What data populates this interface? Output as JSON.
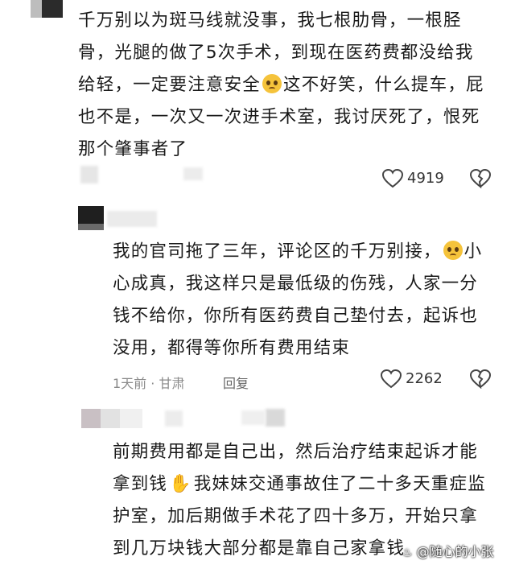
{
  "comment1": {
    "text": "千万别以为斑马线就没事，我七根肋骨，一根胫骨，光腿的做了5次手术，到现在医药费都没给我给轻，一定要注意安全🥺这不好笑，什么提车，屁也不是，一次又一次进手术室，我讨厌死了，恨死那个肇事者了",
    "likes": "4919"
  },
  "comment2": {
    "text": "我的官司拖了三年，评论区的千万别接，🥺小心成真，我这样只是最低级的伤残，人家一分钱不给你，你所有医药费自己垫付去，起诉也没用，都得等你所有费用结束",
    "time_location": "1天前 · 甘肃",
    "reply_label": "回复",
    "likes": "2262"
  },
  "comment3": {
    "text": "前期费用都是自己出，然后治疗结束起诉才能拿到钱🙏我妹妹交通事故住了二十多天重症监护室，加后期做手术花了四十多万，开始只拿到几万块钱大部分都是靠自己家拿钱"
  },
  "watermark": "@随心的小张",
  "icons": {
    "like": "heart-outline-icon",
    "dislike": "broken-heart-icon",
    "emoji_pleading": "pleading-face-emoji",
    "emoji_pray": "praying-hands-emoji"
  },
  "colors": {
    "meta": "#8a8a8a",
    "text": "#1a1a1a"
  }
}
